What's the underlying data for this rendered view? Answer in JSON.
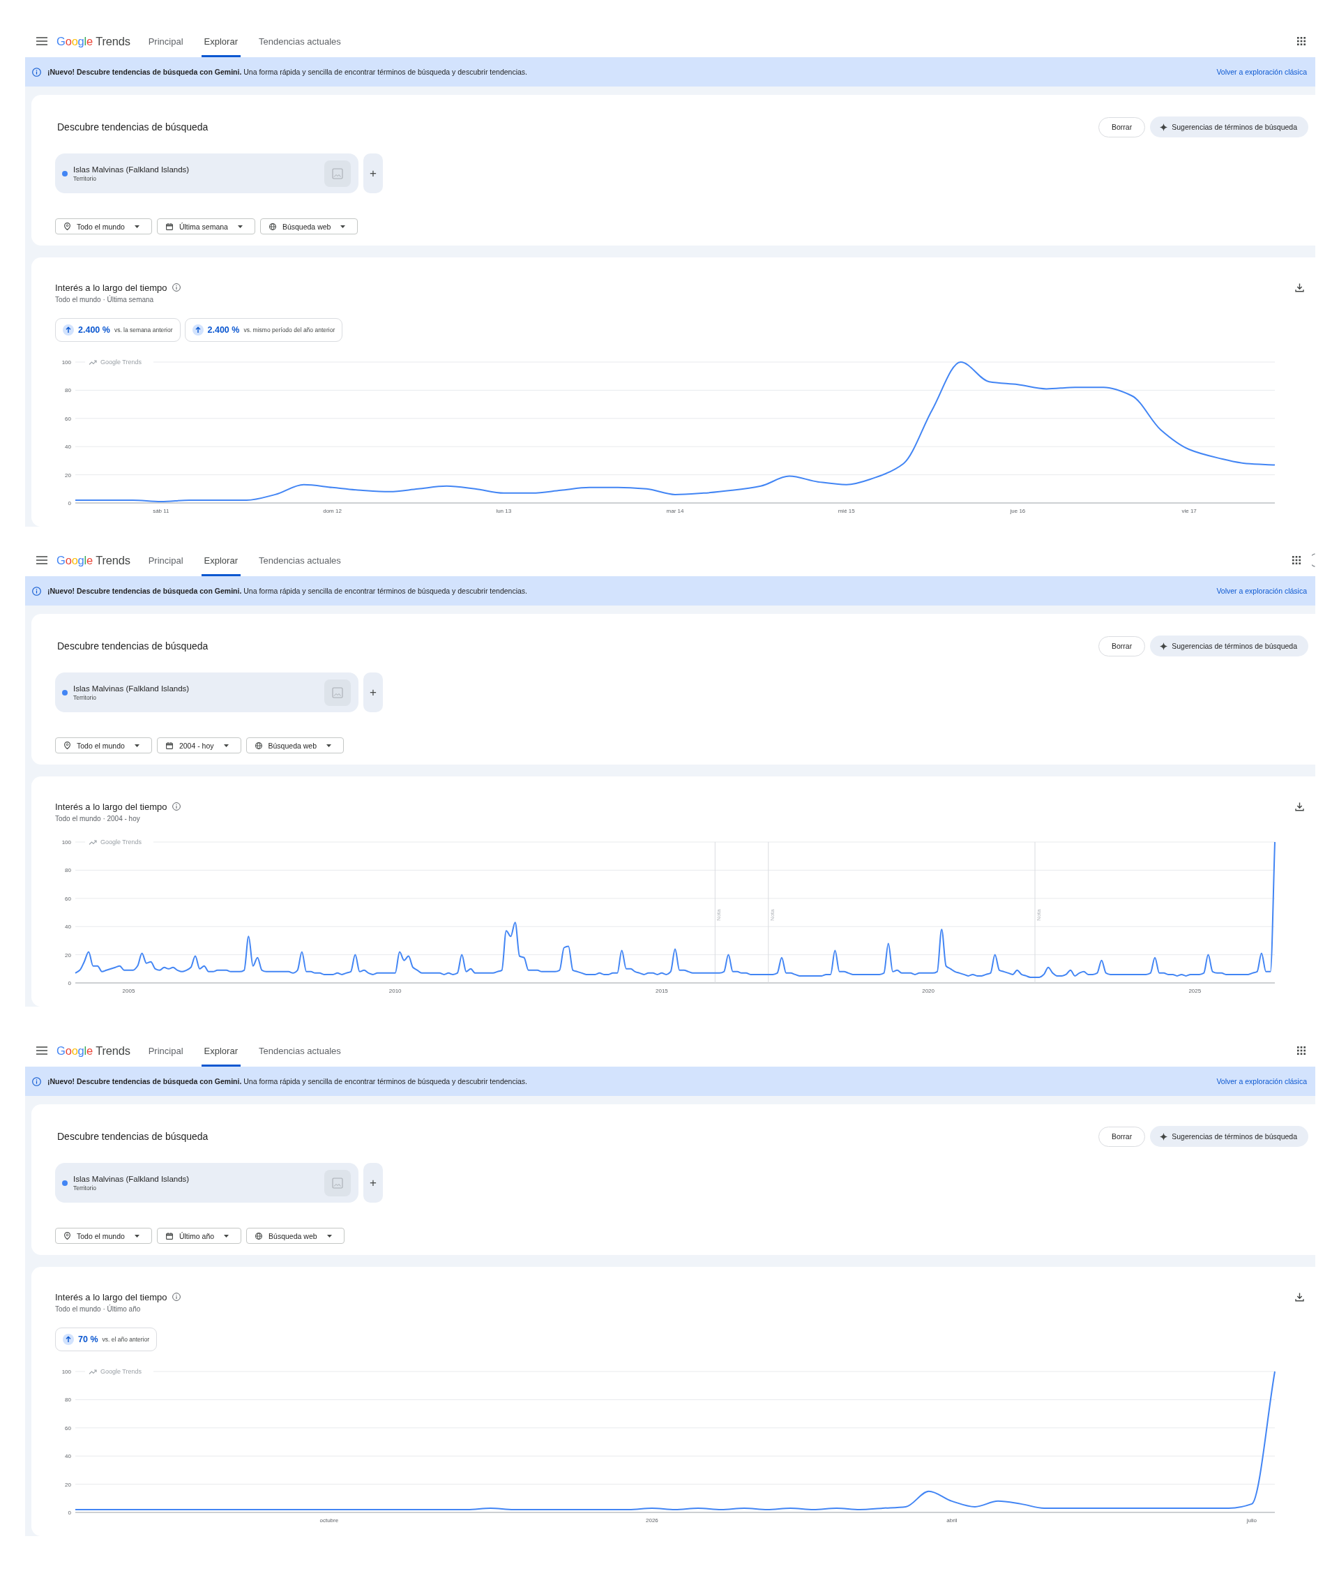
{
  "panels": [
    {
      "header": {
        "brand": "Google",
        "product": "Trends",
        "tabs": [
          {
            "label": "Principal",
            "selected": false
          },
          {
            "label": "Explorar",
            "selected": true
          },
          {
            "label": "Tendencias actuales",
            "selected": false
          }
        ]
      },
      "banner": {
        "text": "**¡Nuevo! Descubre tendencias de búsqueda con Gemini.** Una forma rápida y sencilla de encontrar términos de búsqueda y descubrir tendencias.",
        "link": "Volver a exploración clásica"
      },
      "explore": {
        "title": "Descubre tendencias de búsqueda",
        "clear_button": "Borrar",
        "suggest_button": "Sugerencias de términos de búsqueda",
        "terms": [
          {
            "name": "Islas Malvinas (Falkland Islands)",
            "category": "Territorio",
            "color": "#4285f4"
          }
        ],
        "add_button": "+",
        "filters": [
          {
            "kind": "location",
            "label": "Todo el mundo"
          },
          {
            "kind": "date",
            "label": "Última semana"
          },
          {
            "kind": "property",
            "label": "Búsqueda web"
          }
        ]
      },
      "interest": {
        "title": "Interés a lo largo del tiempo",
        "subtitle": "Todo el mundo · Última semana",
        "stats": [
          {
            "value": "2.400 %",
            "label": "vs. la semana anterior"
          },
          {
            "value": "2.400 %",
            "label": "vs. mismo período del año anterior"
          }
        ],
        "chart_label": "Google Trends",
        "chart_data": {
          "type": "line",
          "grid": true,
          "categories": [
            null,
            null,
            null,
            "sáb 11",
            null,
            null,
            null,
            null,
            null,
            "dom 12",
            null,
            null,
            null,
            null,
            null,
            "lun 13",
            null,
            null,
            null,
            null,
            null,
            "mar 14",
            null,
            null,
            null,
            null,
            null,
            "mié 15",
            null,
            null,
            null,
            null,
            null,
            "jue 16",
            null,
            null,
            null,
            null,
            null,
            "vie 17",
            null,
            null,
            null
          ],
          "ylim": [
            0,
            100
          ],
          "yticks": [
            0,
            20,
            40,
            60,
            80,
            100
          ],
          "series": [
            {
              "color": "#4285f4",
              "values": [
                2,
                2,
                2,
                1,
                2,
                2,
                2,
                6,
                13,
                11,
                9,
                8,
                10,
                12,
                10,
                7,
                7,
                9,
                11,
                11,
                10,
                6,
                7,
                9,
                12,
                19,
                15,
                13,
                18,
                28,
                66,
                100,
                86,
                84,
                81,
                82,
                82,
                76,
                52,
                38,
                32,
                28,
                27
              ]
            }
          ]
        }
      }
    },
    {
      "header": {
        "brand": "Google",
        "product": "Trends",
        "tabs": [
          {
            "label": "Principal",
            "selected": false
          },
          {
            "label": "Explorar",
            "selected": true
          },
          {
            "label": "Tendencias actuales",
            "selected": false
          }
        ],
        "avatar_cut_off": true
      },
      "banner": {
        "text": "**¡Nuevo! Descubre tendencias de búsqueda con Gemini.** Una forma rápida y sencilla de encontrar términos de búsqueda y descubrir tendencias.",
        "link": "Volver a exploración clásica"
      },
      "explore": {
        "title": "Descubre tendencias de búsqueda",
        "clear_button": "Borrar",
        "suggest_button": "Sugerencias de términos de búsqueda",
        "terms": [
          {
            "name": "Islas Malvinas (Falkland Islands)",
            "category": "Territorio",
            "color": "#4285f4"
          }
        ],
        "add_button": "+",
        "filters": [
          {
            "kind": "location",
            "label": "Todo el mundo"
          },
          {
            "kind": "date",
            "label": "2004 - hoy"
          },
          {
            "kind": "property",
            "label": "Búsqueda web"
          }
        ]
      },
      "interest": {
        "title": "Interés a lo largo del tiempo",
        "subtitle": "Todo el mundo · 2004 - hoy",
        "chart_label": "Google Trends",
        "chart_data": {
          "type": "line",
          "grid": true,
          "x": [
            2004,
            2004.083,
            2004.167,
            2004.25,
            2004.333,
            2004.417,
            2004.5,
            2004.583,
            2004.667,
            2004.75,
            2004.833,
            2004.917,
            2005,
            2005.083,
            2005.167,
            2005.25,
            2005.333,
            2005.417,
            2005.5,
            2005.583,
            2005.667,
            2005.75,
            2005.833,
            2005.917,
            2006,
            2006.083,
            2006.167,
            2006.25,
            2006.333,
            2006.417,
            2006.5,
            2006.583,
            2006.667,
            2006.75,
            2006.833,
            2006.917,
            2007,
            2007.083,
            2007.167,
            2007.25,
            2007.333,
            2007.417,
            2007.5,
            2007.583,
            2007.667,
            2007.75,
            2007.833,
            2007.917,
            2008,
            2008.083,
            2008.167,
            2008.25,
            2008.333,
            2008.417,
            2008.5,
            2008.583,
            2008.667,
            2008.75,
            2008.833,
            2008.917,
            2009,
            2009.083,
            2009.167,
            2009.25,
            2009.333,
            2009.417,
            2009.5,
            2009.583,
            2009.667,
            2009.75,
            2009.833,
            2009.917,
            2010,
            2010.083,
            2010.167,
            2010.25,
            2010.333,
            2010.417,
            2010.5,
            2010.583,
            2010.667,
            2010.75,
            2010.833,
            2010.917,
            2011,
            2011.083,
            2011.167,
            2011.25,
            2011.333,
            2011.417,
            2011.5,
            2011.583,
            2011.667,
            2011.75,
            2011.833,
            2011.917,
            2012,
            2012.083,
            2012.167,
            2012.25,
            2012.333,
            2012.417,
            2012.5,
            2012.583,
            2012.667,
            2012.75,
            2012.833,
            2012.917,
            2013,
            2013.083,
            2013.167,
            2013.25,
            2013.333,
            2013.417,
            2013.5,
            2013.583,
            2013.667,
            2013.75,
            2013.833,
            2013.917,
            2014,
            2014.083,
            2014.167,
            2014.25,
            2014.333,
            2014.417,
            2014.5,
            2014.583,
            2014.667,
            2014.75,
            2014.833,
            2014.917,
            2015,
            2015.083,
            2015.167,
            2015.25,
            2015.333,
            2015.417,
            2015.5,
            2015.583,
            2015.667,
            2015.75,
            2015.833,
            2015.917,
            2016,
            2016.083,
            2016.167,
            2016.25,
            2016.333,
            2016.417,
            2016.5,
            2016.583,
            2016.667,
            2016.75,
            2016.833,
            2016.917,
            2017,
            2017.083,
            2017.167,
            2017.25,
            2017.333,
            2017.417,
            2017.5,
            2017.583,
            2017.667,
            2017.75,
            2017.833,
            2017.917,
            2018,
            2018.083,
            2018.167,
            2018.25,
            2018.333,
            2018.417,
            2018.5,
            2018.583,
            2018.667,
            2018.75,
            2018.833,
            2018.917,
            2019,
            2019.083,
            2019.167,
            2019.25,
            2019.333,
            2019.417,
            2019.5,
            2019.583,
            2019.667,
            2019.75,
            2019.833,
            2019.917,
            2020,
            2020.083,
            2020.167,
            2020.25,
            2020.333,
            2020.417,
            2020.5,
            2020.583,
            2020.667,
            2020.75,
            2020.833,
            2020.917,
            2021,
            2021.083,
            2021.167,
            2021.25,
            2021.333,
            2021.417,
            2021.5,
            2021.583,
            2021.667,
            2021.75,
            2021.833,
            2021.917,
            2022,
            2022.083,
            2022.167,
            2022.25,
            2022.333,
            2022.417,
            2022.5,
            2022.583,
            2022.667,
            2022.75,
            2022.833,
            2022.917,
            2023,
            2023.083,
            2023.167,
            2023.25,
            2023.333,
            2023.417,
            2023.5,
            2023.583,
            2023.667,
            2023.75,
            2023.833,
            2023.917,
            2024,
            2024.083,
            2024.167,
            2024.25,
            2024.333,
            2024.417,
            2024.5,
            2024.583,
            2024.667,
            2024.75,
            2024.833,
            2024.917,
            2025,
            2025.083,
            2025.167,
            2025.25,
            2025.333,
            2025.417,
            2025.5,
            2025.583,
            2025.667,
            2025.75,
            2025.833,
            2025.917,
            2026,
            2026.083,
            2026.167,
            2026.25,
            2026.333,
            2026.417,
            2026.5
          ],
          "xlim": [
            2004,
            2026.5
          ],
          "ylim": [
            0,
            100
          ],
          "yticks": [
            0,
            20,
            40,
            60,
            80,
            100
          ],
          "xticks": [
            2005,
            2010,
            2015,
            2020,
            2025
          ],
          "ref_lines": [
            {
              "axis": "x",
              "value": 2016,
              "label": "Nota"
            },
            {
              "axis": "x",
              "value": 2017,
              "label": "Nota"
            },
            {
              "axis": "x",
              "value": 2022,
              "label": "Nota"
            }
          ],
          "series": [
            {
              "color": "#4285f4",
              "values": [
                7,
                9,
                15,
                22,
                12,
                12,
                8,
                9,
                10,
                11,
                12,
                9,
                9,
                9,
                12,
                21,
                14,
                15,
                10,
                9,
                11,
                10,
                11,
                9,
                8,
                9,
                11,
                19,
                10,
                12,
                8,
                8,
                9,
                9,
                9,
                8,
                8,
                8,
                9,
                33,
                12,
                18,
                9,
                8,
                8,
                8,
                8,
                8,
                8,
                7,
                9,
                22,
                8,
                8,
                7,
                7,
                6,
                6,
                6,
                7,
                6,
                7,
                8,
                20,
                8,
                9,
                7,
                6,
                7,
                7,
                7,
                7,
                7,
                22,
                16,
                19,
                11,
                9,
                7,
                7,
                7,
                7,
                7,
                6,
                7,
                6,
                7,
                20,
                8,
                10,
                7,
                7,
                7,
                7,
                7,
                8,
                9,
                37,
                33,
                43,
                19,
                18,
                9,
                9,
                9,
                8,
                8,
                8,
                8,
                9,
                25,
                26,
                9,
                8,
                7,
                6,
                6,
                6,
                7,
                6,
                6,
                7,
                7,
                23,
                10,
                10,
                8,
                7,
                6,
                7,
                7,
                6,
                7,
                6,
                8,
                24,
                9,
                9,
                8,
                7,
                7,
                7,
                7,
                7,
                7,
                7,
                8,
                20,
                8,
                8,
                7,
                7,
                6,
                6,
                6,
                6,
                6,
                6,
                7,
                18,
                7,
                7,
                6,
                5,
                5,
                5,
                5,
                5,
                5,
                6,
                6,
                23,
                8,
                8,
                7,
                6,
                6,
                6,
                6,
                6,
                6,
                6,
                7,
                28,
                8,
                9,
                7,
                7,
                7,
                6,
                7,
                7,
                7,
                7,
                8,
                38,
                12,
                10,
                8,
                7,
                6,
                5,
                6,
                5,
                5,
                6,
                7,
                20,
                9,
                8,
                7,
                6,
                9,
                6,
                5,
                4,
                4,
                4,
                6,
                11,
                7,
                5,
                5,
                6,
                9,
                5,
                7,
                8,
                6,
                6,
                7,
                16,
                7,
                6,
                6,
                6,
                6,
                6,
                6,
                6,
                6,
                6,
                7,
                18,
                7,
                7,
                6,
                6,
                5,
                6,
                5,
                6,
                6,
                6,
                7,
                20,
                8,
                7,
                7,
                6,
                6,
                6,
                6,
                6,
                6,
                7,
                8,
                21,
                8,
                8,
                100
              ]
            }
          ]
        }
      }
    },
    {
      "header": {
        "brand": "Google",
        "product": "Trends",
        "tabs": [
          {
            "label": "Principal",
            "selected": false
          },
          {
            "label": "Explorar",
            "selected": true
          },
          {
            "label": "Tendencias actuales",
            "selected": false
          }
        ]
      },
      "banner": {
        "text": "**¡Nuevo! Descubre tendencias de búsqueda con Gemini.** Una forma rápida y sencilla de encontrar términos de búsqueda y descubrir tendencias.",
        "link": "Volver a exploración clásica"
      },
      "explore": {
        "title": "Descubre tendencias de búsqueda",
        "clear_button": "Borrar",
        "suggest_button": "Sugerencias de términos de búsqueda",
        "terms": [
          {
            "name": "Islas Malvinas (Falkland Islands)",
            "category": "Territorio",
            "color": "#4285f4"
          }
        ],
        "add_button": "+",
        "filters": [
          {
            "kind": "location",
            "label": "Todo el mundo"
          },
          {
            "kind": "date",
            "label": "Último año"
          },
          {
            "kind": "property",
            "label": "Búsqueda web"
          }
        ]
      },
      "interest": {
        "title": "Interés a lo largo del tiempo",
        "subtitle": "Todo el mundo · Último año",
        "stats": [
          {
            "value": "70 %",
            "label": "vs. el año anterior"
          }
        ],
        "chart_label": "Google Trends",
        "chart_data": {
          "type": "line",
          "grid": true,
          "categories": [
            null,
            null,
            null,
            null,
            null,
            null,
            null,
            null,
            null,
            null,
            null,
            "octubre",
            null,
            null,
            null,
            null,
            null,
            null,
            null,
            null,
            null,
            null,
            null,
            null,
            null,
            "2026",
            null,
            null,
            null,
            null,
            null,
            null,
            null,
            null,
            null,
            null,
            null,
            null,
            "abril",
            null,
            null,
            null,
            null,
            null,
            null,
            null,
            null,
            null,
            null,
            null,
            null,
            "julio",
            null
          ],
          "ylim": [
            0,
            100
          ],
          "yticks": [
            0,
            20,
            40,
            60,
            80,
            100
          ],
          "series": [
            {
              "color": "#4285f4",
              "values": [
                2,
                2,
                2,
                2,
                2,
                2,
                2,
                2,
                2,
                2,
                2,
                2,
                2,
                2,
                2,
                2,
                2,
                2,
                3,
                2,
                2,
                2,
                2,
                2,
                2,
                3,
                2,
                3,
                2,
                3,
                2,
                3,
                2,
                3,
                2,
                3,
                4,
                15,
                8,
                4,
                8,
                6,
                3,
                3,
                3,
                3,
                3,
                3,
                3,
                3,
                3,
                6,
                100
              ]
            }
          ]
        }
      }
    }
  ]
}
